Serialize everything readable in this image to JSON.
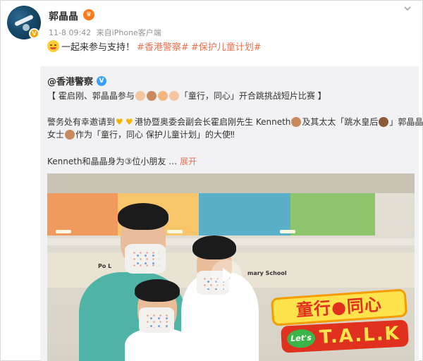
{
  "header": {
    "username": "郭晶晶",
    "timestamp": "11-8 09:42",
    "source_prefix": "来自",
    "source": "iPhone客户端",
    "vip_icon": "flame-badge-icon",
    "verified_badge": "V"
  },
  "post": {
    "text": "一起来参与支持！",
    "hashtags": [
      "#香港警察#",
      "#保护儿童计划#"
    ],
    "emoji": "grin-emoji-icon"
  },
  "repost": {
    "author": "@香港警察",
    "verified": "V",
    "line1": "【 霍启刚、郭晶晶参与",
    "line1_tail": "「童行，同心」开合跳挑战短片比赛 】",
    "line2_a": "警务处有幸邀请到",
    "line2_b": "港协暨奥委会副会长霍启刚先生 Kenneth",
    "line2_c": "及其太太「跳水皇后",
    "line2_d": "」郭晶晶",
    "line3_a": "女士",
    "line3_b": "作为「童行，同心 保护儿童计划」的大使‼",
    "line4": "Kenneth和晶晶身为",
    "line4_num": "③",
    "line4_b": "位小朋友 …",
    "unfold": "展开"
  },
  "video": {
    "school_left": "Po L",
    "school_right": "mary School",
    "logo_top": "童行●同心",
    "logo_lets": "Let's",
    "logo_talk": "T.A.L.K"
  },
  "colors": {
    "hashtag": "#eb7350",
    "meta": "#939393",
    "repost_bg": "#f2f2f5"
  }
}
